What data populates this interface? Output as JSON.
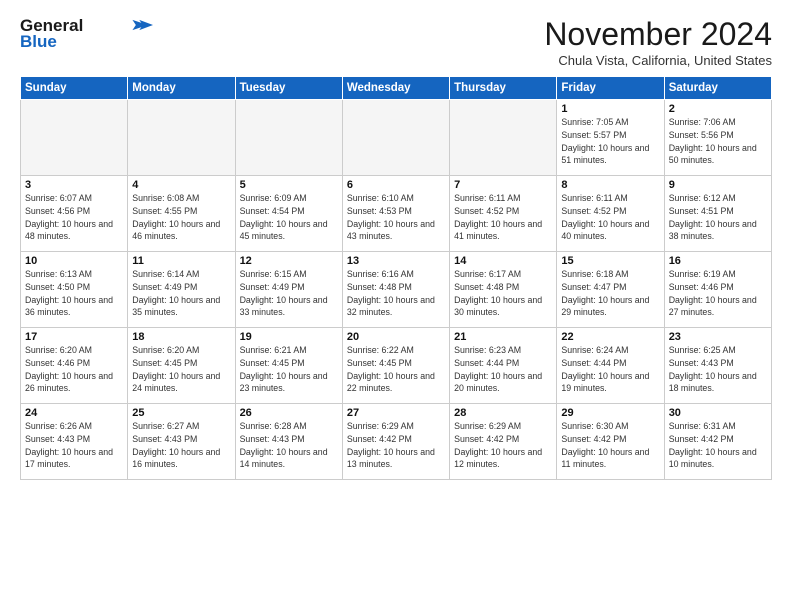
{
  "logo": {
    "line1": "General",
    "line2": "Blue"
  },
  "title": "November 2024",
  "location": "Chula Vista, California, United States",
  "days_header": [
    "Sunday",
    "Monday",
    "Tuesday",
    "Wednesday",
    "Thursday",
    "Friday",
    "Saturday"
  ],
  "weeks": [
    [
      {
        "day": "",
        "info": ""
      },
      {
        "day": "",
        "info": ""
      },
      {
        "day": "",
        "info": ""
      },
      {
        "day": "",
        "info": ""
      },
      {
        "day": "",
        "info": ""
      },
      {
        "day": "1",
        "info": "Sunrise: 7:05 AM\nSunset: 5:57 PM\nDaylight: 10 hours\nand 51 minutes."
      },
      {
        "day": "2",
        "info": "Sunrise: 7:06 AM\nSunset: 5:56 PM\nDaylight: 10 hours\nand 50 minutes."
      }
    ],
    [
      {
        "day": "3",
        "info": "Sunrise: 6:07 AM\nSunset: 4:56 PM\nDaylight: 10 hours\nand 48 minutes."
      },
      {
        "day": "4",
        "info": "Sunrise: 6:08 AM\nSunset: 4:55 PM\nDaylight: 10 hours\nand 46 minutes."
      },
      {
        "day": "5",
        "info": "Sunrise: 6:09 AM\nSunset: 4:54 PM\nDaylight: 10 hours\nand 45 minutes."
      },
      {
        "day": "6",
        "info": "Sunrise: 6:10 AM\nSunset: 4:53 PM\nDaylight: 10 hours\nand 43 minutes."
      },
      {
        "day": "7",
        "info": "Sunrise: 6:11 AM\nSunset: 4:52 PM\nDaylight: 10 hours\nand 41 minutes."
      },
      {
        "day": "8",
        "info": "Sunrise: 6:11 AM\nSunset: 4:52 PM\nDaylight: 10 hours\nand 40 minutes."
      },
      {
        "day": "9",
        "info": "Sunrise: 6:12 AM\nSunset: 4:51 PM\nDaylight: 10 hours\nand 38 minutes."
      }
    ],
    [
      {
        "day": "10",
        "info": "Sunrise: 6:13 AM\nSunset: 4:50 PM\nDaylight: 10 hours\nand 36 minutes."
      },
      {
        "day": "11",
        "info": "Sunrise: 6:14 AM\nSunset: 4:49 PM\nDaylight: 10 hours\nand 35 minutes."
      },
      {
        "day": "12",
        "info": "Sunrise: 6:15 AM\nSunset: 4:49 PM\nDaylight: 10 hours\nand 33 minutes."
      },
      {
        "day": "13",
        "info": "Sunrise: 6:16 AM\nSunset: 4:48 PM\nDaylight: 10 hours\nand 32 minutes."
      },
      {
        "day": "14",
        "info": "Sunrise: 6:17 AM\nSunset: 4:48 PM\nDaylight: 10 hours\nand 30 minutes."
      },
      {
        "day": "15",
        "info": "Sunrise: 6:18 AM\nSunset: 4:47 PM\nDaylight: 10 hours\nand 29 minutes."
      },
      {
        "day": "16",
        "info": "Sunrise: 6:19 AM\nSunset: 4:46 PM\nDaylight: 10 hours\nand 27 minutes."
      }
    ],
    [
      {
        "day": "17",
        "info": "Sunrise: 6:20 AM\nSunset: 4:46 PM\nDaylight: 10 hours\nand 26 minutes."
      },
      {
        "day": "18",
        "info": "Sunrise: 6:20 AM\nSunset: 4:45 PM\nDaylight: 10 hours\nand 24 minutes."
      },
      {
        "day": "19",
        "info": "Sunrise: 6:21 AM\nSunset: 4:45 PM\nDaylight: 10 hours\nand 23 minutes."
      },
      {
        "day": "20",
        "info": "Sunrise: 6:22 AM\nSunset: 4:45 PM\nDaylight: 10 hours\nand 22 minutes."
      },
      {
        "day": "21",
        "info": "Sunrise: 6:23 AM\nSunset: 4:44 PM\nDaylight: 10 hours\nand 20 minutes."
      },
      {
        "day": "22",
        "info": "Sunrise: 6:24 AM\nSunset: 4:44 PM\nDaylight: 10 hours\nand 19 minutes."
      },
      {
        "day": "23",
        "info": "Sunrise: 6:25 AM\nSunset: 4:43 PM\nDaylight: 10 hours\nand 18 minutes."
      }
    ],
    [
      {
        "day": "24",
        "info": "Sunrise: 6:26 AM\nSunset: 4:43 PM\nDaylight: 10 hours\nand 17 minutes."
      },
      {
        "day": "25",
        "info": "Sunrise: 6:27 AM\nSunset: 4:43 PM\nDaylight: 10 hours\nand 16 minutes."
      },
      {
        "day": "26",
        "info": "Sunrise: 6:28 AM\nSunset: 4:43 PM\nDaylight: 10 hours\nand 14 minutes."
      },
      {
        "day": "27",
        "info": "Sunrise: 6:29 AM\nSunset: 4:42 PM\nDaylight: 10 hours\nand 13 minutes."
      },
      {
        "day": "28",
        "info": "Sunrise: 6:29 AM\nSunset: 4:42 PM\nDaylight: 10 hours\nand 12 minutes."
      },
      {
        "day": "29",
        "info": "Sunrise: 6:30 AM\nSunset: 4:42 PM\nDaylight: 10 hours\nand 11 minutes."
      },
      {
        "day": "30",
        "info": "Sunrise: 6:31 AM\nSunset: 4:42 PM\nDaylight: 10 hours\nand 10 minutes."
      }
    ]
  ]
}
